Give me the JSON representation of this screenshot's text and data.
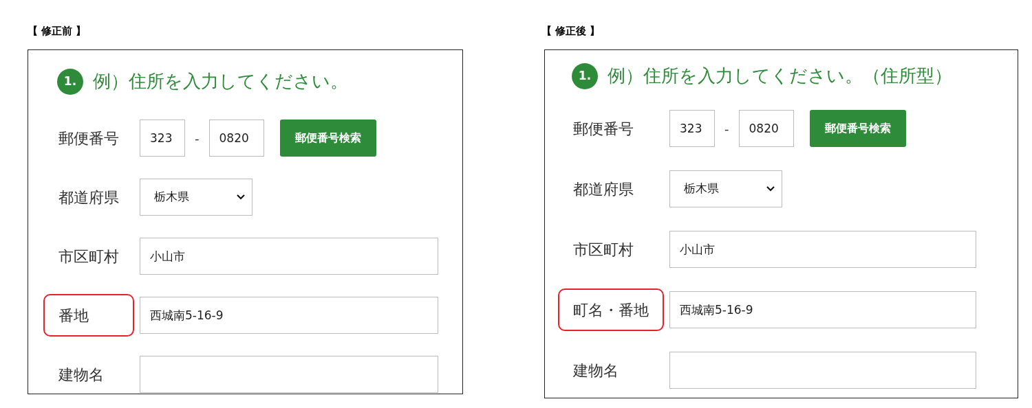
{
  "panels": [
    {
      "caption": "【 修正前 】",
      "step_number": "1.",
      "heading": "例）住所を入力してください。",
      "fields": [
        {
          "kind": "postal",
          "label": "郵便番号",
          "part_1": "323",
          "separator": "-",
          "part_2": "0820",
          "button": "郵便番号検索",
          "highlighted": false
        },
        {
          "kind": "select",
          "label": "都道府県",
          "value": "栃木県",
          "highlighted": false
        },
        {
          "kind": "text",
          "label": "市区町村",
          "value": "小山市",
          "highlighted": false
        },
        {
          "kind": "text",
          "label": "番地",
          "value": "西城南5-16-9",
          "highlighted": true
        },
        {
          "kind": "text",
          "label": "建物名",
          "highlighted": false
        }
      ]
    },
    {
      "caption": "【 修正後 】",
      "step_number": "1.",
      "heading": "例）住所を入力してください。（住所型）",
      "fields": [
        {
          "kind": "postal",
          "label": "郵便番号",
          "part_1": "323",
          "separator": "-",
          "part_2": "0820",
          "button": "郵便番号検索",
          "highlighted": false
        },
        {
          "kind": "select",
          "label": "都道府県",
          "value": "栃木県",
          "highlighted": false
        },
        {
          "kind": "text",
          "label": "市区町村",
          "value": "小山市",
          "highlighted": false
        },
        {
          "kind": "text",
          "label": "町名・番地",
          "value": "西城南5-16-9",
          "highlighted": true
        },
        {
          "kind": "text",
          "label": "建物名",
          "highlighted": false
        }
      ]
    }
  ]
}
